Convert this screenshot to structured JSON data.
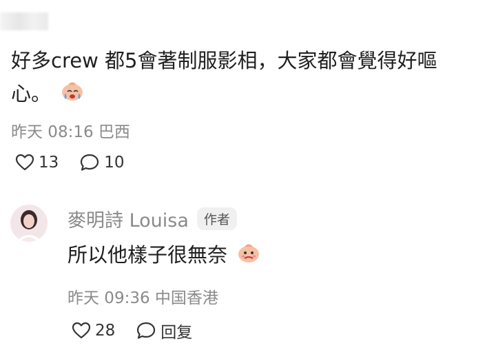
{
  "comment": {
    "text_line1": "好多crew 都5會著制服影相，大家都會覺得好嘔",
    "text_line2": "心。",
    "meta": "昨天 08:16 巴西",
    "likes": "13",
    "replies": "10"
  },
  "reply": {
    "author": "麥明詩 Louisa",
    "badge": "作者",
    "text": "所以他樣子很無奈",
    "meta": "昨天 09:36 中国香港",
    "likes": "28",
    "reply_label": "回复"
  },
  "icons": [
    "heart-icon",
    "comment-bubble-icon",
    "crying-face-emoji",
    "awkward-face-emoji"
  ]
}
